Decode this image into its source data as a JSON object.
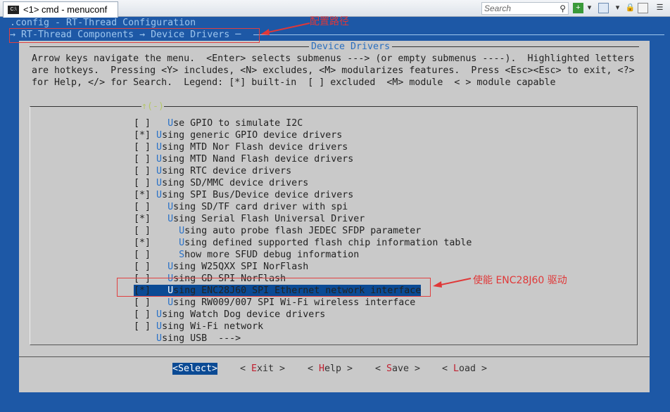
{
  "window": {
    "tab_title": "<1> cmd - menuconf",
    "search_placeholder": "Search"
  },
  "header": {
    "config_line": ".config - RT-Thread Configuration",
    "breadcrumb": "→ RT-Thread Components → Device Drivers ─"
  },
  "dialog": {
    "title": "Device Drivers",
    "help_lines": [
      "Arrow keys navigate the menu.  <Enter> selects submenus ---> (or empty submenus ----).  Highlighted letters",
      "are hotkeys.  Pressing <Y> includes, <N> excludes, <M> modularizes features.  Press <Esc><Esc> to exit, <?>",
      "for Help, </> for Search.  Legend: [*] built-in  [ ] excluded  <M> module  < > module capable"
    ],
    "more_indicator": "↑(-)",
    "items": [
      {
        "box": "[ ]",
        "pad": "   ",
        "hk": "U",
        "rest": "se GPIO to simulate I2C"
      },
      {
        "box": "[*]",
        "pad": " ",
        "hk": "U",
        "rest": "sing generic GPIO device drivers"
      },
      {
        "box": "[ ]",
        "pad": " ",
        "hk": "U",
        "rest": "sing MTD Nor Flash device drivers"
      },
      {
        "box": "[ ]",
        "pad": " ",
        "hk": "U",
        "rest": "sing MTD Nand Flash device drivers"
      },
      {
        "box": "[ ]",
        "pad": " ",
        "hk": "U",
        "rest": "sing RTC device drivers"
      },
      {
        "box": "[ ]",
        "pad": " ",
        "hk": "U",
        "rest": "sing SD/MMC device drivers"
      },
      {
        "box": "[*]",
        "pad": " ",
        "hk": "U",
        "rest": "sing SPI Bus/Device device drivers"
      },
      {
        "box": "[ ]",
        "pad": "   ",
        "hk": "U",
        "rest": "sing SD/TF card driver with spi"
      },
      {
        "box": "[*]",
        "pad": "   ",
        "hk": "U",
        "rest": "sing Serial Flash Universal Driver"
      },
      {
        "box": "[ ]",
        "pad": "     ",
        "hk": "U",
        "rest": "sing auto probe flash JEDEC SFDP parameter"
      },
      {
        "box": "[*]",
        "pad": "     ",
        "hk": "U",
        "rest": "sing defined supported flash chip information table"
      },
      {
        "box": "[ ]",
        "pad": "     ",
        "hk": "S",
        "rest": "how more SFUD debug information"
      },
      {
        "box": "[ ]",
        "pad": "   ",
        "hk": "U",
        "rest": "sing W25QXX SPI NorFlash"
      },
      {
        "box": "[ ]",
        "pad": "   ",
        "hk": "U",
        "rest": "sing GD SPI NorFlash"
      },
      {
        "box": "[*]",
        "pad": "   ",
        "hk": "U",
        "rest": "sing ENC28J60 SPI Ethernet network interface",
        "selected": true
      },
      {
        "box": "[ ]",
        "pad": "   ",
        "hk": "U",
        "rest": "sing RW009/007 SPI Wi-Fi wireless interface"
      },
      {
        "box": "[ ]",
        "pad": " ",
        "hk": "U",
        "rest": "sing Watch Dog device drivers"
      },
      {
        "box": "[ ]",
        "pad": " ",
        "hk": "U",
        "rest": "sing Wi-Fi network"
      },
      {
        "box": "   ",
        "pad": " ",
        "hk": "U",
        "rest": "sing USB  --->"
      }
    ],
    "buttons": [
      {
        "pre": "<",
        "hk": "S",
        "rest": "elect>"
      },
      {
        "pre": "< ",
        "hk": "E",
        "rest": "xit >"
      },
      {
        "pre": "< ",
        "hk": "H",
        "rest": "elp >"
      },
      {
        "pre": "< ",
        "hk": "S",
        "rest": "ave >"
      },
      {
        "pre": "< ",
        "hk": "L",
        "rest": "oad >"
      }
    ]
  },
  "annotations": {
    "path_note": "配置路径",
    "enable_note": "使能 ENC28J60 驱动"
  }
}
